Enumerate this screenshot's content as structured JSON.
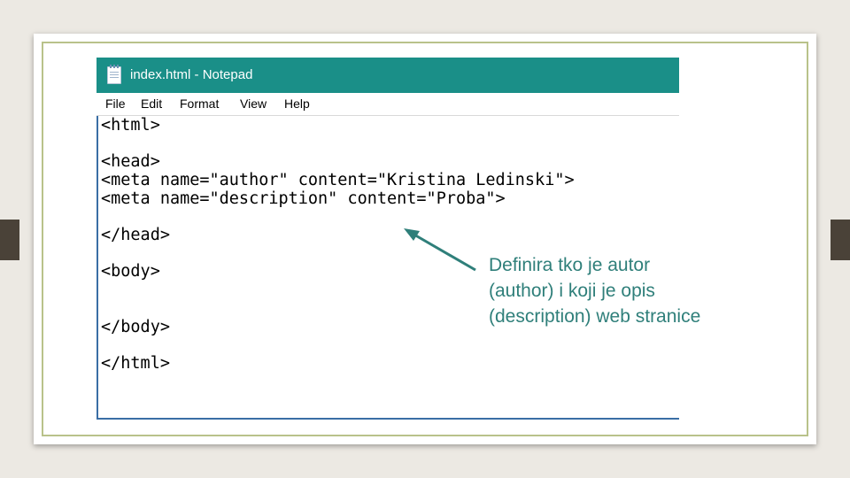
{
  "window": {
    "title": "index.html - Notepad"
  },
  "menu": [
    "File",
    "Edit",
    "Format",
    "View",
    "Help"
  ],
  "editor": {
    "lines": [
      "<html>",
      "<head>",
      "<meta name=\"author\" content=\"Kristina Ledinski\">",
      "<meta name=\"description\" content=\"Proba\">",
      "</head>",
      "<body>",
      "</body>",
      "</html>"
    ]
  },
  "annotation": {
    "lines": [
      "Definira tko je autor",
      "(author) i koji je opis",
      "(description) web stranice"
    ],
    "color": "#2f7f7a"
  },
  "colors": {
    "titlebar": "#1a8f88",
    "frame": "#b9c28a",
    "arrow": "#2f7f7a"
  }
}
